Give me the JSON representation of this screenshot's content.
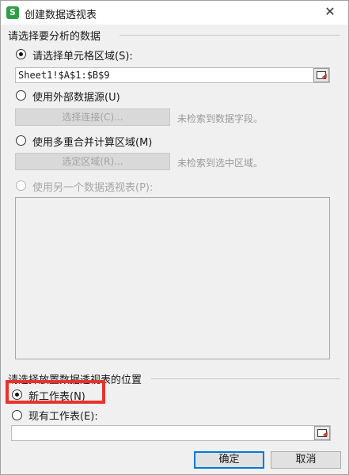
{
  "window": {
    "title": "创建数据透视表",
    "app_icon": "S",
    "close_glyph": "✕"
  },
  "source_group": {
    "title": "请选择要分析的数据",
    "options": {
      "cell_range": {
        "label": "请选择单元格区域(S):",
        "checked": true,
        "value": "Sheet1!$A$1:$B$9"
      },
      "external": {
        "label": "使用外部数据源(U)",
        "checked": false,
        "button": "选择连接(C)...",
        "hint": "未检索到数据字段。"
      },
      "consolidate": {
        "label": "使用多重合并计算区域(M)",
        "checked": false,
        "button": "选定区域(R)...",
        "hint": "未检索到选中区域。"
      },
      "another_pivot": {
        "label": "使用另一个数据透视表(P):",
        "checked": false,
        "disabled": true
      }
    }
  },
  "location_group": {
    "title": "请选择放置数据透视表的位置",
    "options": {
      "new_sheet": {
        "label": "新工作表(N)",
        "checked": true
      },
      "existing_sheet": {
        "label": "现有工作表(E):",
        "checked": false,
        "value": ""
      }
    }
  },
  "buttons": {
    "ok": "确定",
    "cancel": "取消"
  },
  "colors": {
    "highlight": "#e8332c",
    "app_icon": "#2f9e44",
    "primary_border": "#0078d7"
  },
  "icons": [
    "app-icon",
    "close-icon",
    "range-picker-icon"
  ]
}
